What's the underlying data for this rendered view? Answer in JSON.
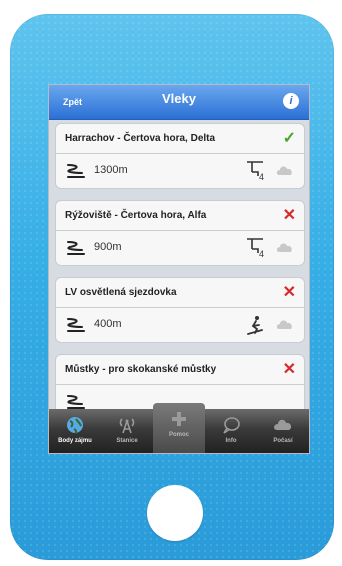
{
  "header": {
    "back_label": "Zpět",
    "title": "Vleky",
    "info_label": "i"
  },
  "lifts": [
    {
      "name": "Harrachov - Čertova hora, Delta",
      "length": "1300m",
      "status": "open",
      "status_symbol": "✓",
      "status_color": "#4aa52e",
      "skier_icon": "chairlift-4-icon"
    },
    {
      "name": "Rýžoviště - Čertova hora, Alfa",
      "length": "900m",
      "status": "closed",
      "status_symbol": "✕",
      "status_color": "#d62a2a",
      "skier_icon": "chairlift-4-icon"
    },
    {
      "name": "LV osvětlená sjezdovka",
      "length": "400m",
      "status": "closed",
      "status_symbol": "✕",
      "status_color": "#d62a2a",
      "skier_icon": "skier-icon"
    },
    {
      "name": "Můstky - pro skokanské můstky",
      "length": "",
      "status": "closed",
      "status_symbol": "✕",
      "status_color": "#d62a2a",
      "skier_icon": "chairlift-icon"
    }
  ],
  "tabbar": {
    "items": [
      {
        "label": "Body zájmu",
        "icon": "globe-icon",
        "active": true
      },
      {
        "label": "Stanice",
        "icon": "antenna-icon",
        "active": false
      },
      {
        "label": "Pomoc",
        "icon": "plus-icon",
        "active": false
      },
      {
        "label": "Info",
        "icon": "speech-bubble-icon",
        "active": false
      },
      {
        "label": "Počasí",
        "icon": "cloud-icon",
        "active": false
      }
    ]
  }
}
